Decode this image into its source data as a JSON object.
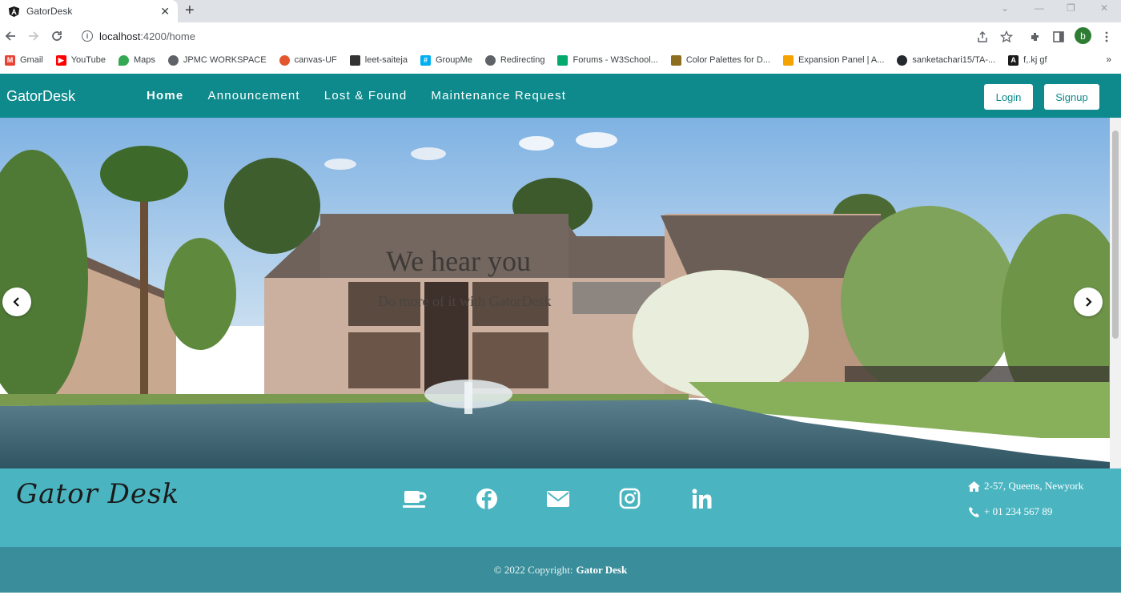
{
  "browser": {
    "tab_title": "GatorDesk",
    "url_host": "localhost",
    "url_path": ":4200/home",
    "profile_initial": "b",
    "bookmarks": [
      {
        "label": "Gmail",
        "color": "#ea4335"
      },
      {
        "label": "YouTube",
        "color": "#ff0000"
      },
      {
        "label": "Maps",
        "color": "#34a853"
      },
      {
        "label": "JPMC WORKSPACE",
        "color": "#5f6368"
      },
      {
        "label": "canvas-UF",
        "color": "#e4572e"
      },
      {
        "label": "leet-saiteja",
        "color": "#333333"
      },
      {
        "label": "GroupMe",
        "color": "#00aff0"
      },
      {
        "label": "Redirecting",
        "color": "#5f6368"
      },
      {
        "label": "Forums - W3School...",
        "color": "#04aa6d"
      },
      {
        "label": "Color Palettes for D...",
        "color": "#8d6e1f"
      },
      {
        "label": "Expansion Panel | A...",
        "color": "#f4a300"
      },
      {
        "label": "sanketachari15/TA-...",
        "color": "#24292f"
      },
      {
        "label": "f,.kj gf",
        "color": "#1a1a1a"
      }
    ]
  },
  "nav": {
    "brand": "GatorDesk",
    "links": [
      "Home",
      "Announcement",
      "Lost & Found",
      "Maintenance Request"
    ],
    "login": "Login",
    "signup": "Signup",
    "color": "#0e8a8c"
  },
  "hero": {
    "title": "We hear you",
    "subtitle": "Do more of it with GatorDesk"
  },
  "footer": {
    "logo": "Gator Desk",
    "social_icons": [
      "coffee-icon",
      "facebook-icon",
      "envelope-icon",
      "instagram-icon",
      "linkedin-icon"
    ],
    "address": "2-57, Queens, Newyork",
    "phone": "+ 01 234 567 89",
    "copyright_prefix": "© 2022 Copyright:",
    "copyright_owner": "Gator Desk",
    "color": "#4ab5c1"
  }
}
